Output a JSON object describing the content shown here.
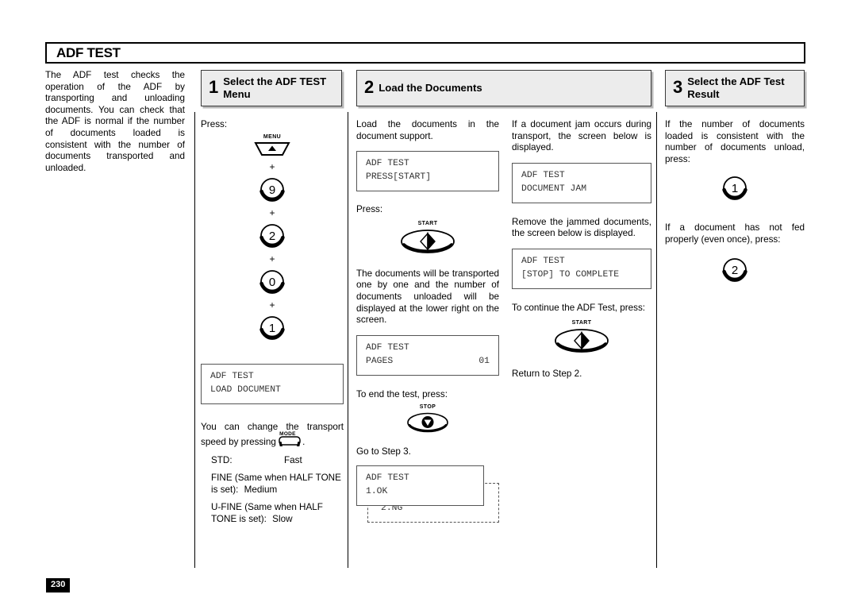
{
  "page": {
    "title": "ADF TEST",
    "page_number": "230"
  },
  "intro": {
    "text": "The ADF test checks the operation of the ADF by transporting and unloading documents. You can check that the ADF is normal if the number of documents loaded is consistent with the number of documents transported and unloaded."
  },
  "steps": [
    {
      "number": "1",
      "label": "Select the ADF TEST Menu"
    },
    {
      "number": "2",
      "label": "Load the Documents"
    },
    {
      "number": "3",
      "label": "Select the ADF Test Result"
    }
  ],
  "step1": {
    "press_label": "Press:",
    "keys": [
      {
        "icon": "menu-key-icon",
        "label": "MENU",
        "value": ""
      },
      {
        "icon": "plus-separator",
        "label": "",
        "value": "+"
      },
      {
        "icon": "numeric-key-icon",
        "label": "",
        "value": "9"
      },
      {
        "icon": "plus-separator",
        "label": "",
        "value": "+"
      },
      {
        "icon": "numeric-key-icon",
        "label": "",
        "value": "2"
      },
      {
        "icon": "plus-separator",
        "label": "",
        "value": "+"
      },
      {
        "icon": "numeric-key-icon",
        "label": "",
        "value": "0"
      },
      {
        "icon": "plus-separator",
        "label": "",
        "value": "+"
      },
      {
        "icon": "numeric-key-icon",
        "label": "",
        "value": "1"
      }
    ],
    "lcd": {
      "line1": "ADF TEST",
      "line2": "LOAD DOCUMENT"
    },
    "speed_text_a": "You can change the transport speed by pressing",
    "speed_key_label": "MODE",
    "speed_text_b": ".",
    "speed_rows": [
      {
        "name": "STD:",
        "value": "Fast"
      },
      {
        "name": "FINE (Same when HALF TONE is set):",
        "value": "Medium"
      },
      {
        "name": "U-FINE (Same when HALF TONE is set):",
        "value": "Slow"
      }
    ]
  },
  "step2": {
    "p1": "Load the documents in the document support.",
    "lcd1": {
      "line1": "ADF TEST",
      "line2": "PRESS[START]"
    },
    "press_label": "Press:",
    "start_key_label": "START",
    "p2": "The documents will be transported one by one and the number of documents unloaded will be displayed at the lower right on the screen.",
    "lcd2": {
      "line1": "ADF TEST",
      "line2_left": "PAGES",
      "line2_right": "01"
    },
    "p3": "To end the test, press:",
    "stop_key_label": "STOP",
    "p4": "Go to Step 3.",
    "lcd3": {
      "line1": "ADF TEST",
      "line2": "1.OK",
      "alt_line": "2.NG"
    }
  },
  "step2b": {
    "p1": "If a document jam occurs during transport, the screen below is displayed.",
    "lcd1": {
      "line1": "ADF TEST",
      "line2": "DOCUMENT JAM"
    },
    "p2": "Remove the jammed documents, the screen below is displayed.",
    "lcd2": {
      "line1": "ADF TEST",
      "line2": "[STOP] TO COMPLETE"
    },
    "p3": "To continue the ADF Test, press:",
    "start_key_label": "START",
    "p4": "Return to Step 2."
  },
  "step3": {
    "p1": "If the number of documents loaded is consistent with the number of documents unload, press:",
    "key1": "1",
    "p2": "If a document has not fed properly (even once), press:",
    "key2": "2"
  }
}
